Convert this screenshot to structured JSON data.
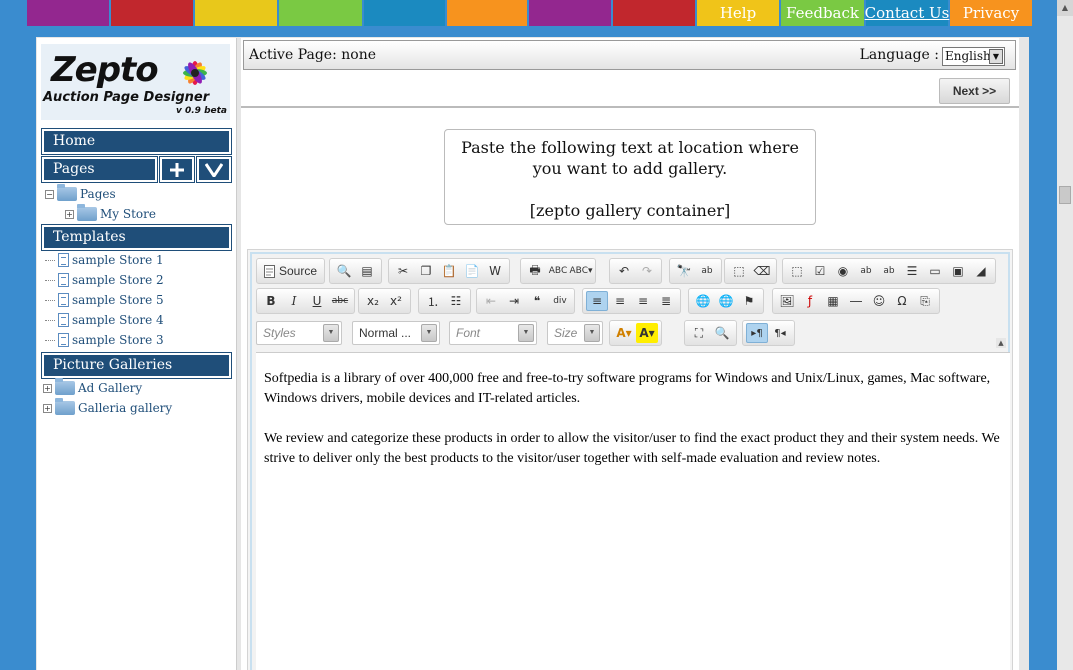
{
  "topnav": {
    "links": [
      {
        "label": "Help",
        "color": "#f0c419"
      },
      {
        "label": "Feedback",
        "color": "#7ac943"
      },
      {
        "label": "Contact Us",
        "color": "#1b8ac0"
      },
      {
        "label": "Privacy",
        "color": "#f7931e"
      }
    ],
    "stripe_colors": [
      "#93278f",
      "#c1272d",
      "#e8c81b",
      "#7ac943",
      "#1b8ac0",
      "#f7931e",
      "#93278f",
      "#c1272d"
    ]
  },
  "logo": {
    "name": "Zepto",
    "subtitle": "Auction Page Designer",
    "version": "v 0.9 beta"
  },
  "sidebar": {
    "home": "Home",
    "pages": "Pages",
    "pages_tree": {
      "root": "Pages",
      "child": "My Store"
    },
    "templates": "Templates",
    "template_items": [
      "sample Store 1",
      "sample Store 2",
      "sample Store 5",
      "sample Store 4",
      "sample Store 3"
    ],
    "galleries": "Picture Galleries",
    "gallery_items": [
      "Ad Gallery",
      "Galleria gallery"
    ]
  },
  "header": {
    "active_page": "Active Page: none",
    "language_label": "Language :",
    "language_value": "English"
  },
  "next_button": "Next >>",
  "paste_box": {
    "line1": "Paste the following text at location where",
    "line2": "you want to add gallery.",
    "code": "[zepto gallery container]"
  },
  "toolbar": {
    "source": "Source",
    "styles": "Styles",
    "format": "Normal ...",
    "font": "Font",
    "size": "Size"
  },
  "content": {
    "p1": "Softpedia is a library of over 400,000 free and free-to-try software programs for Windows and Unix/Linux, games, Mac software, Windows drivers, mobile devices and IT-related articles.",
    "p2": "We review and categorize these products in order to allow the visitor/user to find the exact product they and their system needs. We strive to deliver only the best products to the visitor/user together with self-made evaluation and review notes."
  }
}
